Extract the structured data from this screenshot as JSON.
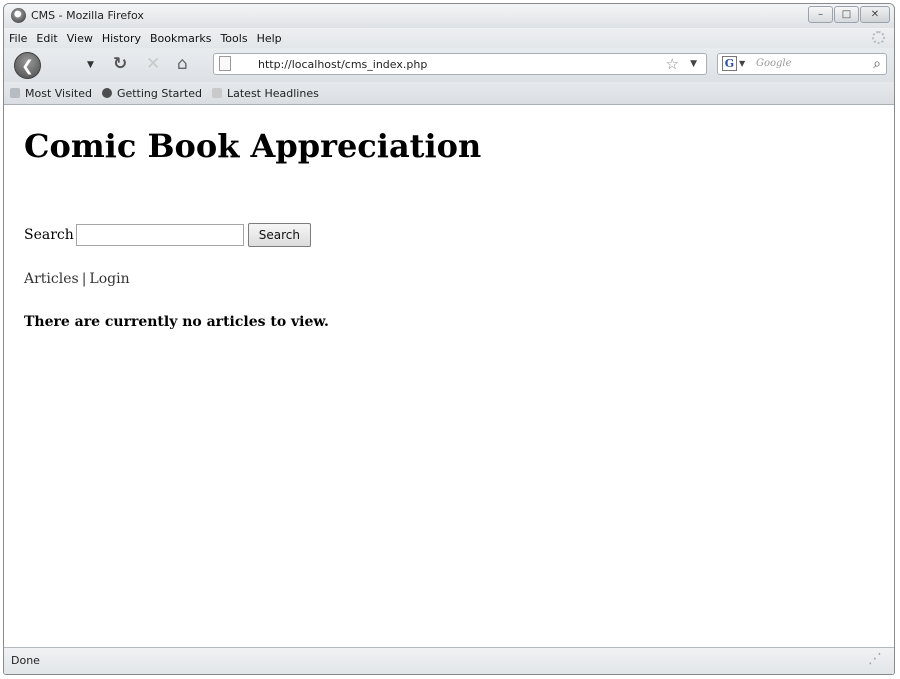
{
  "window": {
    "title": "CMS - Mozilla Firefox",
    "controls": {
      "minimize": "–",
      "maximize": "□",
      "close": "✕"
    }
  },
  "menubar": {
    "items": [
      "File",
      "Edit",
      "View",
      "History",
      "Bookmarks",
      "Tools",
      "Help"
    ]
  },
  "navbar": {
    "url": "http://localhost/cms_index.php",
    "search_placeholder": "Google",
    "search_engine_letter": "G"
  },
  "bookmarks": {
    "items": [
      "Most Visited",
      "Getting Started",
      "Latest Headlines"
    ]
  },
  "page": {
    "title": "Comic Book Appreciation",
    "search_label": "Search",
    "search_value": "",
    "search_button": "Search",
    "links": [
      "Articles",
      "Login"
    ],
    "link_separator": "|",
    "notice": "There are currently no articles to view."
  },
  "statusbar": {
    "text": "Done"
  }
}
